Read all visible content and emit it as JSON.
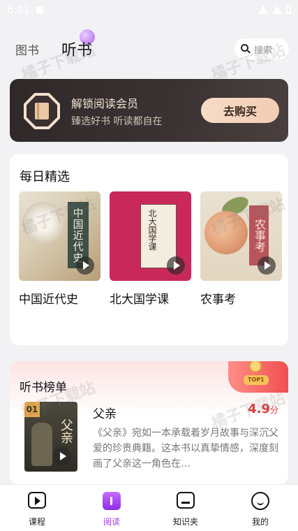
{
  "status_bar": {
    "time": "6:01"
  },
  "header": {
    "tabs": [
      {
        "label": "图书",
        "active": false
      },
      {
        "label": "听书",
        "active": true
      }
    ],
    "search_placeholder": "搜索"
  },
  "vip_banner": {
    "title": "解锁阅读会员",
    "subtitle": "臻选好书 听读都自在",
    "button_label": "去购买"
  },
  "daily_picks": {
    "title": "每日精选",
    "books": [
      {
        "name": "中国近代史",
        "cover_text": "中国近代史"
      },
      {
        "name": "北大国学课",
        "cover_text": "北大国学课"
      },
      {
        "name": "农事考",
        "cover_text": "农事考"
      }
    ]
  },
  "ranking": {
    "title": "听书榜单",
    "badge_text": "TOP1",
    "items": [
      {
        "rank": "01",
        "name": "父亲",
        "cover_text": "父亲",
        "score": "4.9",
        "score_unit": "分",
        "description": "《父亲》宛如一本承载着岁月故事与深沉父爱的珍贵典籍。这本书以真挚情感，深度刻画了父亲这一角色在…"
      }
    ]
  },
  "bottom_nav": {
    "items": [
      {
        "label": "课程",
        "icon": "course-icon",
        "active": false
      },
      {
        "label": "阅读",
        "icon": "read-icon",
        "active": true
      },
      {
        "label": "知识夹",
        "icon": "folder-icon",
        "active": false
      },
      {
        "label": "我的",
        "icon": "profile-icon",
        "active": false
      }
    ]
  },
  "watermark": "橘子下载站",
  "colors": {
    "accent": "#9b3df2",
    "score": "#e23a3a",
    "vip_bg": "#2f2829",
    "vip_button": "#f7dcc6"
  }
}
